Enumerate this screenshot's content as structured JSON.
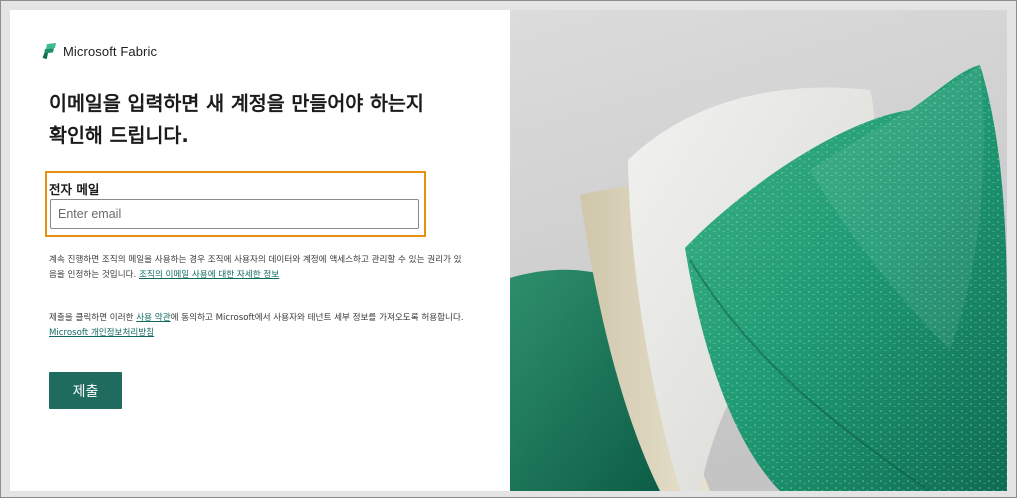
{
  "brand": {
    "name": "Microsoft Fabric",
    "icon": "fabric-logo-icon"
  },
  "form": {
    "heading": "이메일을 입력하면 새 계정을 만들어야 하는지 확인해 드립니다.",
    "email_label": "전자 메일",
    "email_placeholder": "Enter email",
    "email_value": "",
    "notice1_text": "계속 진행하면 조직의 메일을 사용하는 경우 조직에 사용자의 데이터와 계정에 액세스하고 관리할 수 있는 권리가 있음을 인정하는 것입니다. ",
    "notice1_link": "조직의 이메일 사용에 대한 자세한 정보",
    "notice2_prefix": "제출을 클릭하면 이러한 ",
    "notice2_link1": "사용 약관",
    "notice2_middle": "에 동의하고 Microsoft에서 사용자와 테넌트 세부 정보를 가져오도록 허용합니다. ",
    "notice2_link2": "Microsoft 개인정보처리방침",
    "submit_label": "제출"
  },
  "colors": {
    "accent": "#1f6c5f",
    "highlight_border": "#e8900f",
    "link": "#116a62"
  }
}
